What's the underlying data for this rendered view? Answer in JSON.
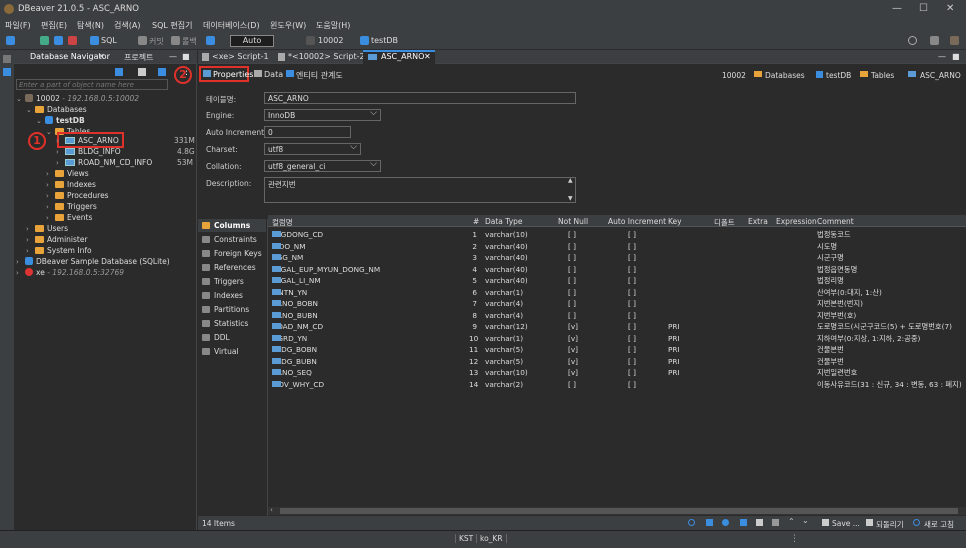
{
  "window": {
    "title": "DBeaver 21.0.5 - ASC_ARNO"
  },
  "menu": [
    "파일(F)",
    "편집(E)",
    "탐색(N)",
    "검색(A)",
    "SQL 편집기",
    "데이터베이스(D)",
    "윈도우(W)",
    "도움말(H)"
  ],
  "toolbar": {
    "sql": "SQL",
    "commit": "커밋",
    "rollback": "롤백",
    "mode": "Auto",
    "connection": "10002",
    "database": "testDB"
  },
  "navigator": {
    "tab1": "Database Navigator",
    "tab2": "프로젝트",
    "filter_placeholder": "Enter a part of object name here",
    "conn_name": "10002",
    "conn_host": "- 192.168.0.5:10002",
    "databases": "Databases",
    "db": "testDB",
    "tables": "Tables",
    "table1": "ASC_ARNO",
    "table1_size": "331M",
    "table2": "BLDG_INFO",
    "table2_size": "4.8G",
    "table3": "ROAD_NM_CD_INFO",
    "table3_size": "53M",
    "views": "Views",
    "indexes": "Indexes",
    "procedures": "Procedures",
    "triggers": "Triggers",
    "events": "Events",
    "users": "Users",
    "administer": "Administer",
    "sysinfo": "System Info",
    "sample": "DBeaver Sample Database (SQLite)",
    "xe": "xe",
    "xe_host": "- 192.168.0.5:32769"
  },
  "annotations": {
    "one": "1",
    "two": "2"
  },
  "editor_tabs": [
    "<xe> Script-1",
    "*<10002> Script-2",
    "ASC_ARNO"
  ],
  "subtabs": {
    "properties": "Properties",
    "data": "Data",
    "er": "엔티티 관계도"
  },
  "breadcrumb": {
    "conn": "10002",
    "databases": "Databases",
    "db": "testDB",
    "tables": "Tables",
    "table": "ASC_ARNO"
  },
  "props": {
    "name_label": "테이블명:",
    "name": "ASC_ARNO",
    "engine_label": "Engine:",
    "engine": "InnoDB",
    "autoinc_label": "Auto Increment:",
    "autoinc": "0",
    "charset_label": "Charset:",
    "charset": "utf8",
    "collation_label": "Collation:",
    "collation": "utf8_general_ci",
    "desc_label": "Description:",
    "desc": "관련지번"
  },
  "sections": [
    "Columns",
    "Constraints",
    "Foreign Keys",
    "References",
    "Triggers",
    "Indexes",
    "Partitions",
    "Statistics",
    "DDL",
    "Virtual"
  ],
  "grid": {
    "headers": [
      "컬럼명",
      "#",
      "Data Type",
      "Not Null",
      "Auto Increment",
      "Key",
      "디폴트",
      "Extra",
      "Expression",
      "Comment"
    ],
    "rows": [
      [
        "LEGDONG_CD",
        "1",
        "varchar(10)",
        "[ ]",
        "[ ]",
        "",
        "법정동코드"
      ],
      [
        "SIDO_NM",
        "2",
        "varchar(40)",
        "[ ]",
        "[ ]",
        "",
        "시도명"
      ],
      [
        "SGG_NM",
        "3",
        "varchar(40)",
        "[ ]",
        "[ ]",
        "",
        "시군구명"
      ],
      [
        "LEGAL_EUP_MYUN_DONG_NM",
        "4",
        "varchar(40)",
        "[ ]",
        "[ ]",
        "",
        "법정읍면동명"
      ],
      [
        "LEGAL_LI_NM",
        "5",
        "varchar(40)",
        "[ ]",
        "[ ]",
        "",
        "법정리명"
      ],
      [
        "MNTN_YN",
        "6",
        "varchar(1)",
        "[ ]",
        "[ ]",
        "",
        "산여부(0:대지, 1:산)"
      ],
      [
        "ARNO_BOBN",
        "7",
        "varchar(4)",
        "[ ]",
        "[ ]",
        "",
        "지번본번(번지)"
      ],
      [
        "ARNO_BUBN",
        "8",
        "varchar(4)",
        "[ ]",
        "[ ]",
        "",
        "지번부번(호)"
      ],
      [
        "ROAD_NM_CD",
        "9",
        "varchar(12)",
        "[v]",
        "[ ]",
        "PRI",
        "도로명코드(시군구코드(5) + 도로명번호(7)"
      ],
      [
        "UGRD_YN",
        "10",
        "varchar(1)",
        "[v]",
        "[ ]",
        "PRI",
        "지하여부(0:지상, 1:지하, 2:공중)"
      ],
      [
        "BLDG_BOBN",
        "11",
        "varchar(5)",
        "[v]",
        "[ ]",
        "PRI",
        "건물본번"
      ],
      [
        "BLDG_BUBN",
        "12",
        "varchar(5)",
        "[v]",
        "[ ]",
        "PRI",
        "건물부번"
      ],
      [
        "ARNO_SEQ",
        "13",
        "varchar(10)",
        "[v]",
        "[ ]",
        "PRI",
        "지번일련번호"
      ],
      [
        "MOV_WHY_CD",
        "14",
        "varchar(2)",
        "[ ]",
        "[ ]",
        "",
        "이동사유코드(31 : 신규, 34 : 변동, 63 : 폐지)"
      ]
    ]
  },
  "status": {
    "items": "14 Items",
    "save": "Save ...",
    "revert": "되돌리기",
    "refresh": "새로 고침"
  },
  "bottom": {
    "tz": "KST",
    "locale": "ko_KR"
  }
}
